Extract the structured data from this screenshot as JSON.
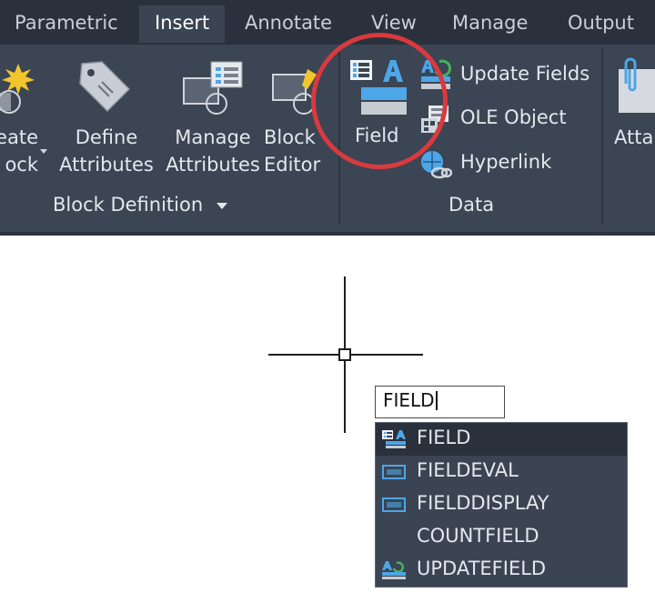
{
  "tabs": [
    "Parametric",
    "Insert",
    "Annotate",
    "View",
    "Manage",
    "Output"
  ],
  "active_tab": "Insert",
  "block_panel": {
    "create_block": [
      "eate",
      "ock"
    ],
    "define_attributes": [
      "Define",
      "Attributes"
    ],
    "manage_attributes": [
      "Manage",
      "Attributes"
    ],
    "block_editor": [
      "Block",
      "Editor"
    ],
    "title": "Block Definition"
  },
  "data_panel": {
    "field": "Field",
    "update_fields": "Update Fields",
    "ole_object": "OLE Object",
    "hyperlink": "Hyperlink",
    "title": "Data"
  },
  "attach_label": "Atta",
  "command_line": {
    "value": "FIELD"
  },
  "autocomplete": [
    {
      "label": "FIELD",
      "icon": "field-icon",
      "selected": true
    },
    {
      "label": "FIELDEVAL",
      "icon": "field-box-icon",
      "selected": false
    },
    {
      "label": "FIELDDISPLAY",
      "icon": "field-box-icon",
      "selected": false
    },
    {
      "label": "COUNTFIELD",
      "icon": "",
      "selected": false
    },
    {
      "label": "UPDATEFIELD",
      "icon": "update-field-icon",
      "selected": false
    }
  ],
  "colors": {
    "ribbon": "#3b4553",
    "tabbar": "#2a313c",
    "highlight": "#d83a3f",
    "accent": "#4da6e8"
  }
}
